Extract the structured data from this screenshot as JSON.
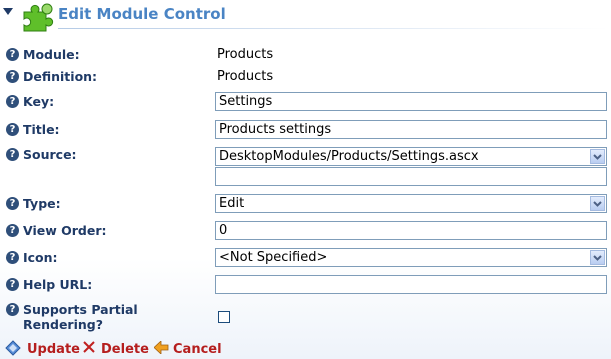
{
  "header": {
    "title": "Edit Module Control"
  },
  "fields": {
    "module": {
      "label": "Module:",
      "value": "Products"
    },
    "definition": {
      "label": "Definition:",
      "value": "Products"
    },
    "key": {
      "label": "Key:",
      "value": "Settings"
    },
    "title": {
      "label": "Title:",
      "value": "Products settings"
    },
    "source": {
      "label": "Source:",
      "selected": "DesktopModules/Products/Settings.ascx",
      "extra_value": ""
    },
    "type": {
      "label": "Type:",
      "selected": "Edit"
    },
    "view_order": {
      "label": "View Order:",
      "value": "0"
    },
    "icon": {
      "label": "Icon:",
      "selected": "<Not Specified>"
    },
    "help_url": {
      "label": "Help URL:",
      "value": ""
    },
    "partial_rendering": {
      "label": "Supports Partial Rendering?",
      "checked": false
    }
  },
  "actions": {
    "update": "Update",
    "delete": "Delete",
    "cancel": "Cancel"
  },
  "colors": {
    "label": "#1f3a66",
    "title": "#4a84c4",
    "action": "#b51e1e",
    "field_border": "#7f9db9"
  }
}
